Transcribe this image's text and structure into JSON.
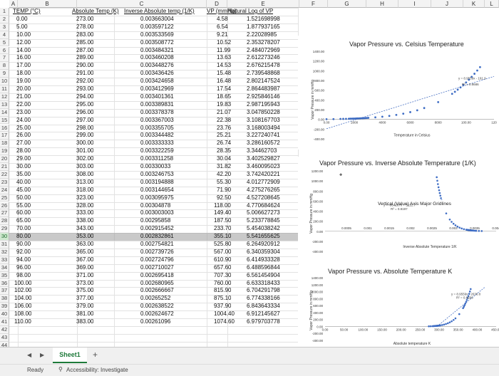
{
  "sheet": {
    "columns": [
      "A",
      "B",
      "C",
      "D",
      "E",
      "F",
      "G",
      "H",
      "I",
      "J",
      "K",
      "L"
    ],
    "headers": [
      "TEMP (°C)",
      "Absolute Temp (K)",
      "Inverse Absolute temp (1/K)",
      "VP (mmHg)",
      "Natural Log of VP"
    ],
    "rows": [
      [
        "0.00",
        "273.00",
        "0.003663004",
        "4.58",
        "1.521698998"
      ],
      [
        "5.00",
        "278.00",
        "0.003597122",
        "6.54",
        "1.877937165"
      ],
      [
        "10.00",
        "283.00",
        "0.003533569",
        "9.21",
        "2.22028985"
      ],
      [
        "12.00",
        "285.00",
        "0.003508772",
        "10.52",
        "2.353278207"
      ],
      [
        "14.00",
        "287.00",
        "0.003484321",
        "11.99",
        "2.484072969"
      ],
      [
        "16.00",
        "289.00",
        "0.003460208",
        "13.63",
        "2.612273246"
      ],
      [
        "17.00",
        "290.00",
        "0.003448276",
        "14.53",
        "2.676215478"
      ],
      [
        "18.00",
        "291.00",
        "0.003436426",
        "15.48",
        "2.739548868"
      ],
      [
        "19.00",
        "292.00",
        "0.003424658",
        "16.48",
        "2.802147524"
      ],
      [
        "20.00",
        "293.00",
        "0.003412969",
        "17.54",
        "2.864483987"
      ],
      [
        "21.00",
        "294.00",
        "0.003401361",
        "18.65",
        "2.925846146"
      ],
      [
        "22.00",
        "295.00",
        "0.003389831",
        "19.83",
        "2.987195943"
      ],
      [
        "23.00",
        "296.00",
        "0.003378378",
        "21.07",
        "3.047850228"
      ],
      [
        "24.00",
        "297.00",
        "0.003367003",
        "22.38",
        "3.108167703"
      ],
      [
        "25.00",
        "298.00",
        "0.003355705",
        "23.76",
        "3.168003494"
      ],
      [
        "26.00",
        "299.00",
        "0.003344482",
        "25.21",
        "3.227240741"
      ],
      [
        "27.00",
        "300.00",
        "0.003333333",
        "26.74",
        "3.286160572"
      ],
      [
        "28.00",
        "301.00",
        "0.003322259",
        "28.35",
        "3.34462703"
      ],
      [
        "29.00",
        "302.00",
        "0.003311258",
        "30.04",
        "3.402529827"
      ],
      [
        "30.00",
        "303.00",
        "0.00330033",
        "31.82",
        "3.460095023"
      ],
      [
        "35.00",
        "308.00",
        "0.003246753",
        "42.20",
        "3.742420221"
      ],
      [
        "40.00",
        "313.00",
        "0.003194888",
        "55.30",
        "4.012772909"
      ],
      [
        "45.00",
        "318.00",
        "0.003144654",
        "71.90",
        "4.275276265"
      ],
      [
        "50.00",
        "323.00",
        "0.003095975",
        "92.50",
        "4.527208645"
      ],
      [
        "55.00",
        "328.00",
        "0.00304878",
        "118.00",
        "4.770684624"
      ],
      [
        "60.00",
        "333.00",
        "0.003003003",
        "149.40",
        "5.006627273"
      ],
      [
        "65.00",
        "338.00",
        "0.00295858",
        "187.50",
        "5.233778845"
      ],
      [
        "70.00",
        "343.00",
        "0.002915452",
        "233.70",
        "5.454038242"
      ],
      [
        "80.00",
        "353.00",
        "0.002832861",
        "355.10",
        "5.541655625"
      ],
      [
        "90.00",
        "363.00",
        "0.002754821",
        "525.80",
        "6.264920912"
      ],
      [
        "92.00",
        "365.00",
        "0.002739726",
        "567.00",
        "6.340359304"
      ],
      [
        "94.00",
        "367.00",
        "0.002724796",
        "610.90",
        "6.414933328"
      ],
      [
        "96.00",
        "369.00",
        "0.002710027",
        "657.60",
        "6.488596844"
      ],
      [
        "98.00",
        "371.00",
        "0.002695418",
        "707.30",
        "6.561454904"
      ],
      [
        "100.00",
        "373.00",
        "0.002680965",
        "760.00",
        "6.633318433"
      ],
      [
        "102.00",
        "375.00",
        "0.002666667",
        "815.90",
        "6.704291798"
      ],
      [
        "104.00",
        "377.00",
        "0.00265252",
        "875.10",
        "6.774338166"
      ],
      [
        "106.00",
        "379.00",
        "0.002638522",
        "937.90",
        "6.843643334"
      ],
      [
        "108.00",
        "381.00",
        "0.002624672",
        "1004.40",
        "6.912145627"
      ],
      [
        "110.00",
        "383.00",
        "0.00261096",
        "1074.60",
        "6.979703778"
      ]
    ],
    "row_numbers": [
      "1",
      "2",
      "3",
      "4",
      "5",
      "6",
      "7",
      "8",
      "9",
      "10",
      "11",
      "12",
      "13",
      "14",
      "15",
      "16",
      "17",
      "18",
      "19",
      "20",
      "21",
      "22",
      "23",
      "24",
      "25",
      "26",
      "27",
      "28",
      "29",
      "30",
      "31",
      "32",
      "33",
      "34",
      "35",
      "36",
      "37",
      "38",
      "39",
      "40",
      "41",
      "42",
      "43",
      "44"
    ],
    "selected_row": "30"
  },
  "charts": {
    "chart1": {
      "title": "Vapor Pressure vs. Celsius Temperature",
      "ylabel": "Vapor Pressure in mmHg",
      "xlabel": "Temperature in Celsius",
      "eq1": "y = 8.9559x - 191.9",
      "eq2": "R² = 0.8686",
      "yticks": [
        "1400.00",
        "1200.00",
        "1000.00",
        "800.00",
        "600.00",
        "400.00",
        "200.00",
        "0.00",
        "-200.00",
        "-400.00"
      ],
      "xticks": [
        "0.00",
        "2000",
        "4000",
        "6000",
        "8000",
        "100.00",
        "120"
      ]
    },
    "chart2": {
      "title": "Vapor Pressure vs. Inverse Absolute Temperature (1/K)",
      "ylabel": "Vapor Pressure in mmHg",
      "xlabel": "Inverse Absolute Temperature 1/K",
      "eq1": "y = -934267x + 3112.7",
      "eq2": "R² = 0.8197",
      "tooltip": "Vertical (Value) Axis Major Gridlines",
      "yticks": [
        "1200.00",
        "1000.00",
        "800.00",
        "600.00",
        "400.00",
        "200.00",
        "0.00",
        "-200.00",
        "-400.00"
      ],
      "xticks": [
        "0.0005",
        "0.001",
        "0.0015",
        "0.002",
        "0.0025",
        "0.003",
        "0.0035",
        "0.004"
      ]
    },
    "chart3": {
      "title": "Vapor Pressure vs. Absolute Temperature K",
      "ylabel": "Vapor Pressure in mmHg",
      "xlabel": "Absolute temperature K",
      "eq1": "y = 8.9559x - 2636.8",
      "eq2": "R² = 0.8686",
      "yticks": [
        "1400.00",
        "1200.00",
        "1000.00",
        "800.00",
        "600.00",
        "400.00",
        "200.00",
        "0.00",
        "-200.00",
        "-400.00"
      ],
      "xticks": [
        "0.00",
        "50.00",
        "100.00",
        "150.00",
        "200.00",
        "250.00",
        "300.00",
        "350.00",
        "400.00",
        "450.00"
      ]
    }
  },
  "tabs": {
    "sheet_label": "Sheet1",
    "add_label": "+"
  },
  "status": {
    "ready": "Ready",
    "accessibility": "Accessibility: Investigate"
  }
}
